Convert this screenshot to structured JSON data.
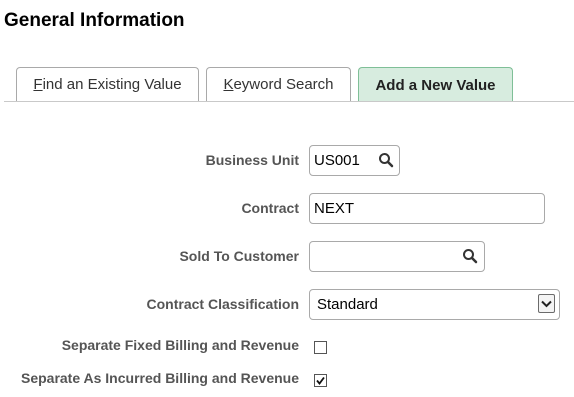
{
  "page": {
    "title": "General Information"
  },
  "tabs": [
    {
      "label_prefix": "",
      "access_key": "F",
      "label_rest": "ind an Existing Value",
      "active": false
    },
    {
      "label_prefix": "",
      "access_key": "K",
      "label_rest": "eyword Search",
      "active": false
    },
    {
      "label": "Add a New Value",
      "active": true
    }
  ],
  "form": {
    "business_unit": {
      "label": "Business Unit",
      "value": "US001",
      "icon": "search-icon"
    },
    "contract": {
      "label": "Contract",
      "value": "NEXT"
    },
    "sold_to_customer": {
      "label": "Sold To Customer",
      "value": "",
      "icon": "search-icon"
    },
    "contract_classification": {
      "label": "Contract Classification",
      "selected": "Standard",
      "icon": "chevron-down-icon"
    },
    "separate_fixed": {
      "label": "Separate Fixed Billing and Revenue",
      "checked": false
    },
    "separate_incurred": {
      "label": "Separate As Incurred Billing and Revenue",
      "checked": true
    }
  },
  "colors": {
    "active_tab_bg": "#d7ecdf",
    "active_tab_border": "#7fbf97",
    "label_text": "#555555"
  }
}
